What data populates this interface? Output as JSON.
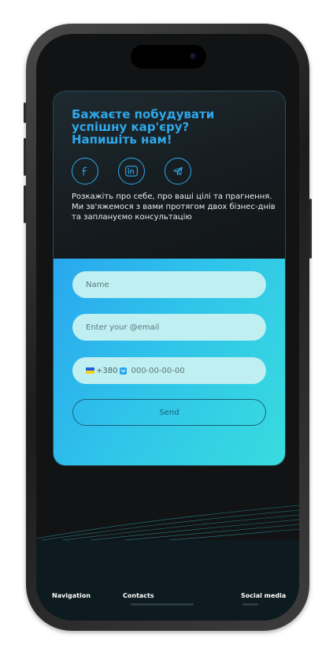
{
  "card": {
    "title": "Бажаєте побудувати\nуспішну кар'єру?\nНапишіть нам!",
    "description": "Розкажіть про себе, про ваші цілі та прагнення. Ми зв'яжемося з вами протягом двох бізнес-днів та заплануємо консультацію",
    "social": [
      {
        "icon": "facebook-icon"
      },
      {
        "icon": "linkedin-icon"
      },
      {
        "icon": "telegram-icon"
      }
    ]
  },
  "form": {
    "name_placeholder": "Name",
    "email_placeholder": "Enter your @email",
    "phone": {
      "country": "Ukraine",
      "dial_code": "+380",
      "placeholder": "000-00-00-00"
    },
    "send_label": "Send"
  },
  "footer": {
    "navigation_label": "Navigation",
    "contacts_label": "Contacts",
    "social_label": "Social media"
  },
  "colors": {
    "accent": "#2ea8ea",
    "form_gradient_start": "#29a7ee",
    "form_gradient_end": "#38dcde",
    "card_dark": "#151b1e",
    "screen_bg": "#111314"
  }
}
